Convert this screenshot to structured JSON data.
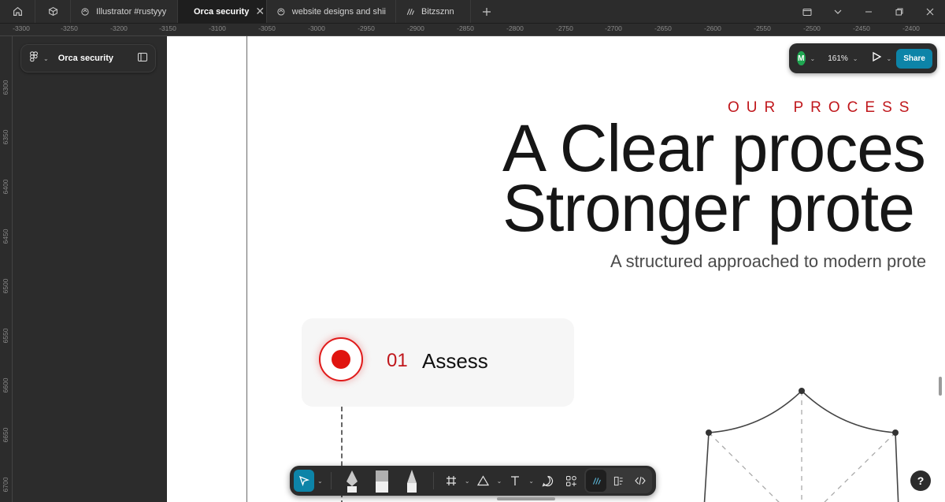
{
  "tabs": [
    {
      "label": "Illustrator #rustyyy",
      "icon": "design-file-icon",
      "active": false
    },
    {
      "label": "Orca security",
      "icon": "pen-file-icon",
      "active": true
    },
    {
      "label": "website designs and shii",
      "icon": "design-file-icon",
      "active": false
    },
    {
      "label": "Bitzsznn",
      "icon": "pen-file-icon",
      "active": false
    }
  ],
  "ruler": {
    "top": [
      "-3300",
      "-3250",
      "-3200",
      "-3150",
      "-3100",
      "-3050",
      "-3000",
      "-2950",
      "-2900",
      "-2850",
      "-2800",
      "-2750",
      "-2700",
      "-2650",
      "-2600",
      "-2550",
      "-2500",
      "-2450",
      "-2400"
    ],
    "left": [
      "6300",
      "6350",
      "6400",
      "6450",
      "6500",
      "6550",
      "6600",
      "6650",
      "6700"
    ]
  },
  "file": {
    "name": "Orca security"
  },
  "top_controls": {
    "avatar_initial": "M",
    "avatar_color": "#1fa651",
    "zoom": "161%",
    "share_label": "Share",
    "accent": "#0d84a8"
  },
  "canvas": {
    "eyebrow": "OUR PROCESS",
    "headline_line1": "A Clear proces",
    "headline_line2": "Stronger prote",
    "subhead": "A structured approached to modern prote",
    "step": {
      "number": "01",
      "label": "Assess"
    },
    "brand_red": "#c0171c"
  },
  "help": {
    "label": "?"
  }
}
